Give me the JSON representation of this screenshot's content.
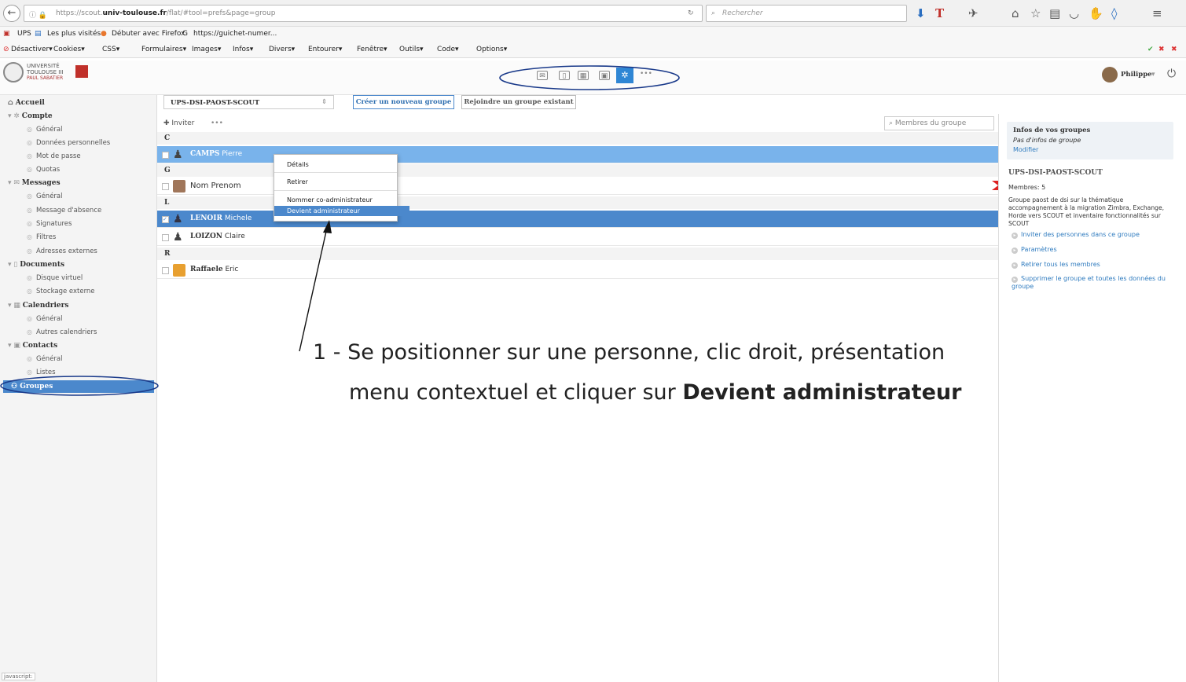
{
  "browser": {
    "url_prefix": "https://scout.",
    "url_host": "univ-toulouse.fr",
    "url_path": "/flat/#tool=prefs&page=group",
    "search_placeholder": "Rechercher",
    "bookmarks": [
      "UPS",
      "Les plus visités",
      "Débuter avec Firefox",
      "https://guichet-numer..."
    ],
    "addons": [
      "Désactiver▾",
      "Cookies▾",
      "CSS▾",
      "Formulaires▾",
      "Images▾",
      "Infos▾",
      "Divers▾",
      "Entourer▾",
      "Fenêtre▾",
      "Outils▾",
      "Code▾",
      "Options▾"
    ]
  },
  "header": {
    "logo_line1": "UNIVERSITÉ",
    "logo_line2": "TOULOUSE III",
    "logo_line3": "PAUL SABATIER",
    "user": "Philippe",
    "user_caret": "▾",
    "more_dots": "•••"
  },
  "sidebar": {
    "accueil": "Accueil",
    "compte": "Compte",
    "compte_items": [
      "Général",
      "Données personnelles",
      "Mot de passe",
      "Quotas"
    ],
    "messages": "Messages",
    "messages_items": [
      "Général",
      "Message d'absence",
      "Signatures",
      "Filtres",
      "Adresses externes"
    ],
    "documents": "Documents",
    "documents_items": [
      "Disque virtuel",
      "Stockage externe"
    ],
    "calendriers": "Calendriers",
    "calendriers_items": [
      "Général",
      "Autres calendriers"
    ],
    "contacts": "Contacts",
    "contacts_items": [
      "Général",
      "Listes"
    ],
    "groupes": "Groupes",
    "footer_badge": "javascript:"
  },
  "toolbar": {
    "group_select": "UPS-DSI-PAOST-SCOUT",
    "create_btn": "Créer un nouveau groupe",
    "join_btn": "Rejoindre un groupe existant",
    "invite": "Inviter",
    "dots": "•••",
    "members_search_placeholder": "Membres du groupe"
  },
  "members": {
    "letter_c": "C",
    "letter_g": "G",
    "letter_l": "L",
    "letter_r": "R",
    "rows": [
      {
        "last": "CAMPS",
        "first": "Pierre"
      },
      {
        "last": "Nom Prenom",
        "first": ""
      },
      {
        "last": "LENOIR",
        "first": "Michele"
      },
      {
        "last": "LOIZON",
        "first": "Claire"
      },
      {
        "last": "Raffaele",
        "first": "Eric"
      }
    ]
  },
  "context_menu": {
    "details": "Détails",
    "retirer": "Retirer",
    "coadmin": "Nommer co-administrateur",
    "admin": "Devient administrateur"
  },
  "right_panel": {
    "info_title": "Infos de vos groupes",
    "info_none": "Pas d'infos de groupe",
    "modify": "Modifier",
    "group_name": "UPS-DSI-PAOST-SCOUT",
    "members_count": "Membres: 5",
    "description": "Groupe paost de dsi sur la thématique accompagnement à la migration Zimbra, Exchange, Horde vers SCOUT et inventaire fonctionnalités sur SCOUT",
    "links": [
      "Inviter des personnes dans ce groupe",
      "Paramètres",
      "Retirer tous les membres",
      "Supprimer le groupe et toutes les données du groupe"
    ]
  },
  "annotation": {
    "line1": "1 - Se positionner sur une personne, clic droit, présentation",
    "line2_pre": "menu contextuel et cliquer sur ",
    "line2_bold": "Devient administrateur"
  },
  "colors": {
    "selected_row": "#79b3eb",
    "selected_row_dark": "#4b88cc",
    "link": "#2f7bbf",
    "annotation_outline": "#1a3a8a"
  }
}
